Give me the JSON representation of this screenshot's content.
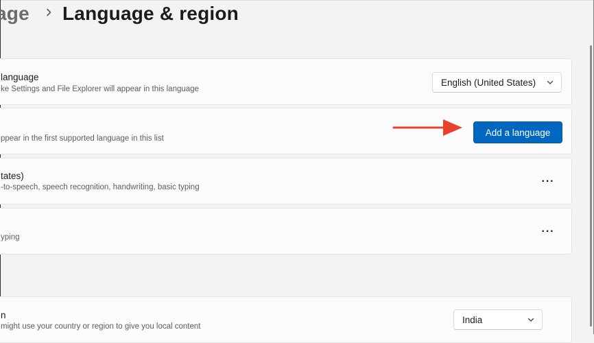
{
  "breadcrumb": {
    "parent": "age",
    "separator_icon": "chevron-right-icon",
    "title": "Language & region"
  },
  "windows_display_language": {
    "title": "language",
    "description": "ke Settings and File Explorer will appear in this language",
    "dropdown_value": "English (United States)",
    "dropdown_icon": "chevron-down-icon"
  },
  "preferred_languages": {
    "description": "ppear in the first supported language in this list",
    "add_button_label": "Add a language"
  },
  "language_items": [
    {
      "title": "tates)",
      "description": "-to-speech, speech recognition, handwriting, basic typing",
      "more_icon": "more-options-icon",
      "more_label": "···"
    },
    {
      "title": "",
      "description": "yping",
      "more_icon": "more-options-icon",
      "more_label": "···"
    }
  ],
  "region": {
    "title": "n",
    "description": "might use your country or region to give you local content",
    "dropdown_value": "India",
    "dropdown_icon": "chevron-down-icon"
  },
  "annotation": {
    "arrow_color": "#e8412c"
  },
  "colors": {
    "accent": "#0067c0",
    "background": "#f3f3f3",
    "card": "#fbfbfb"
  }
}
